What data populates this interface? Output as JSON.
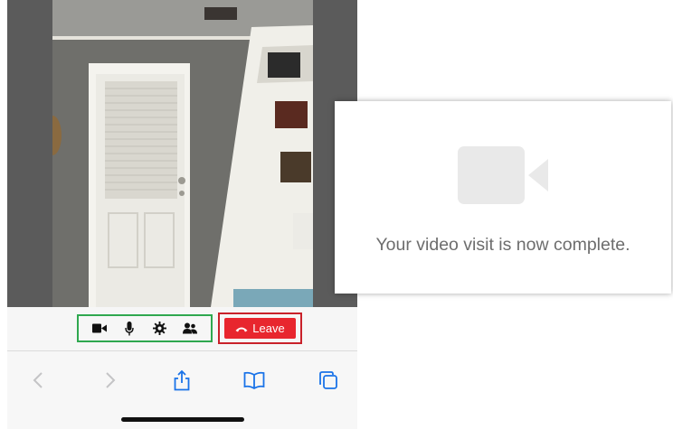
{
  "controls": {
    "camera_icon": "video-camera-icon",
    "mic_icon": "microphone-icon",
    "settings_icon": "gear-icon",
    "participants_icon": "people-icon",
    "leave_label": "Leave",
    "leave_icon": "hang-up-phone-icon",
    "media_group_highlight": "#2fa84f",
    "leave_highlight": "#c9212a",
    "leave_color": "#e8262e"
  },
  "browser_toolbar": {
    "items": [
      "back-chevron-icon",
      "forward-chevron-icon",
      "share-icon",
      "bookmarks-icon",
      "tabs-icon"
    ],
    "accent": "#1a73e8"
  },
  "completion": {
    "icon": "video-camera-icon",
    "message": "Your video visit is now complete."
  }
}
